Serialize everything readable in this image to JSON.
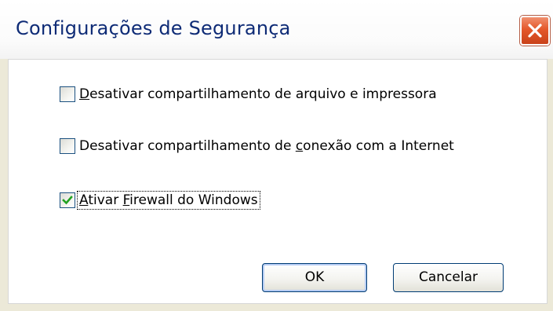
{
  "window": {
    "title": "Configurações de Segurança"
  },
  "options": [
    {
      "label_pre": "",
      "label_mnemonic": "D",
      "label_post": "esativar compartilhamento de arquivo e impressora",
      "checked": false
    },
    {
      "label_pre": "Desativar compartilhamento de ",
      "label_mnemonic": "c",
      "label_post": "onexão com a Internet",
      "checked": false
    },
    {
      "label_pre": "",
      "label_mnemonic": "A",
      "label_post": "tivar ",
      "label_mnemonic2": "F",
      "label_post2": "irewall do Windows",
      "checked": true
    }
  ],
  "buttons": {
    "ok_label": "OK",
    "cancel_label": "Cancelar"
  },
  "colors": {
    "title": "#0e2b76",
    "close_button": "#e4582b",
    "checkbox_border": "#1c5180",
    "check_mark": "#21a121",
    "button_border": "#003c74"
  },
  "icons": {
    "close": "close-icon",
    "check": "checkmark-icon"
  }
}
